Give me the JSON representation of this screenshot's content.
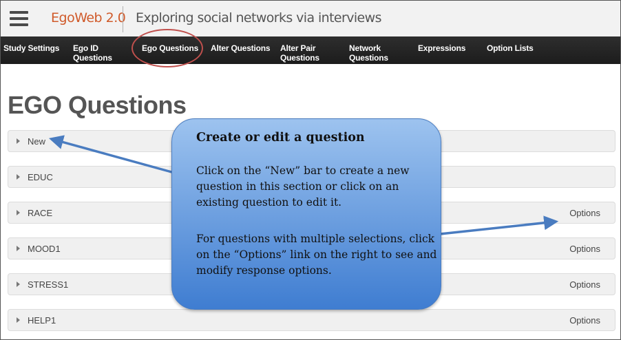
{
  "header": {
    "brand": "EgoWeb 2.0",
    "tagline": "Exploring social networks via interviews"
  },
  "nav": {
    "items": [
      {
        "label_1": "Study Settings",
        "label_2": ""
      },
      {
        "label_1": "Ego ID",
        "label_2": "Questions"
      },
      {
        "label_1": "Ego Questions",
        "label_2": ""
      },
      {
        "label_1": "Alter Questions",
        "label_2": ""
      },
      {
        "label_1": "Alter Pair",
        "label_2": "Questions"
      },
      {
        "label_1": "Network",
        "label_2": "Questions"
      },
      {
        "label_1": "Expressions",
        "label_2": ""
      },
      {
        "label_1": "Option Lists",
        "label_2": ""
      }
    ],
    "active": "Ego Questions"
  },
  "page": {
    "title": "EGO Questions"
  },
  "questions": [
    {
      "label": "New",
      "options": ""
    },
    {
      "label": "EDUC",
      "options": ""
    },
    {
      "label": "RACE",
      "options": "Options"
    },
    {
      "label": "MOOD1",
      "options": "Options"
    },
    {
      "label": "STRESS1",
      "options": "Options"
    },
    {
      "label": "HELP1",
      "options": "Options"
    }
  ],
  "callout": {
    "title": "Create or edit a question",
    "para1": "Click on the “New” bar to create a new question in this section or click on an existing question to edit it.",
    "para2": "For questions with multiple selections, click on the “Options” link on the right to see and modify response options."
  },
  "colors": {
    "brand": "#d05a2a",
    "nav_bg": "#222222",
    "highlight": "#c0504d",
    "callout_top": "#9dc3ef",
    "callout_bottom": "#3f7dd1",
    "arrow": "#4a7cc0"
  }
}
